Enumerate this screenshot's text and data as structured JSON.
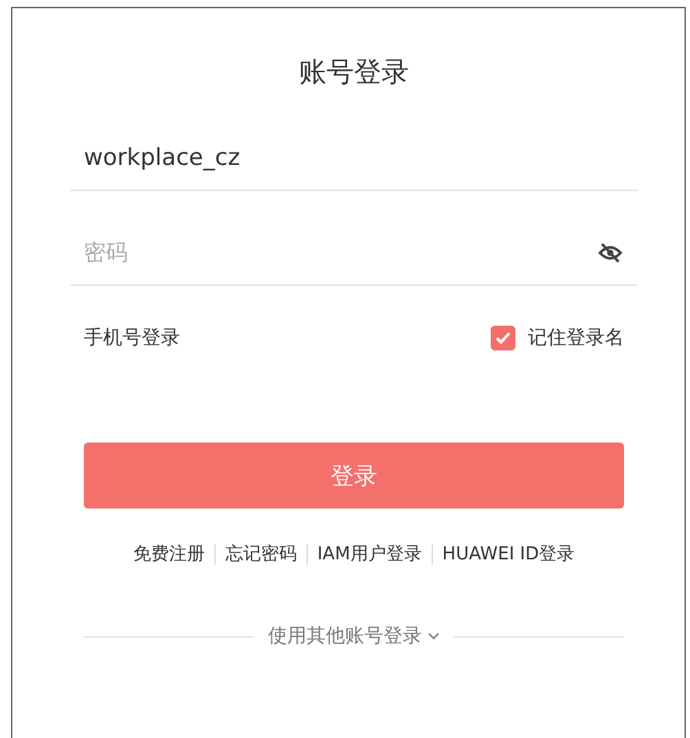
{
  "title": "账号登录",
  "username": {
    "value": "workplace_cz"
  },
  "password": {
    "placeholder": "密码"
  },
  "phone_login": "手机号登录",
  "remember": {
    "label": "记住登录名",
    "checked": true
  },
  "login_button": "登录",
  "links": [
    "免费注册",
    "忘记密码",
    "IAM用户登录",
    "HUAWEI ID登录"
  ],
  "other_login": "使用其他账号登录"
}
